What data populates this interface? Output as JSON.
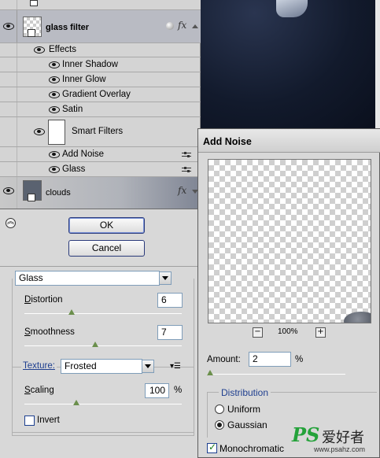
{
  "layers_panel": {
    "rows": [
      {
        "name": "glass filter"
      },
      {
        "name": "Effects"
      },
      {
        "name": "Inner Shadow"
      },
      {
        "name": "Inner Glow"
      },
      {
        "name": "Gradient Overlay"
      },
      {
        "name": "Satin"
      },
      {
        "name": "Smart Filters"
      },
      {
        "name": "Add Noise"
      },
      {
        "name": "Glass"
      },
      {
        "name": "clouds"
      }
    ],
    "fx_glyph": "fx"
  },
  "glass_dialog": {
    "ok_label": "OK",
    "cancel_label": "Cancel",
    "filter_select": "Glass",
    "distortion_label": "Distortion",
    "distortion_value": "6",
    "distortion_fraction": 0.3,
    "smoothness_label": "Smoothness",
    "smoothness_value": "7",
    "smoothness_fraction": 0.45,
    "texture_label": "Texture:",
    "texture_value": "Frosted",
    "scaling_label": "Scaling",
    "scaling_value": "100",
    "scaling_unit": "%",
    "scaling_fraction": 0.33,
    "invert_label": "Invert",
    "invert_checked": false
  },
  "noise_dialog": {
    "title": "Add Noise",
    "zoom_minus": "−",
    "zoom_level": "100%",
    "zoom_plus": "+",
    "amount_label": "Amount:",
    "amount_value": "2",
    "amount_unit": "%",
    "amount_fraction": 0.02,
    "distribution_label": "Distribution",
    "uniform_label": "Uniform",
    "gaussian_label": "Gaussian",
    "selected_distribution": "Gaussian",
    "monochromatic_label": "Monochromatic",
    "monochromatic_checked": true
  },
  "watermark": {
    "logo": "PS",
    "cn_text": "爱好者",
    "url": "www.psahz.com"
  },
  "colors": {
    "slider_knob": "#6b8f4c",
    "distribution_heading": "#1f3f8f",
    "texture_link": "#1f3f8f",
    "watermark_green": "#24a23a"
  }
}
